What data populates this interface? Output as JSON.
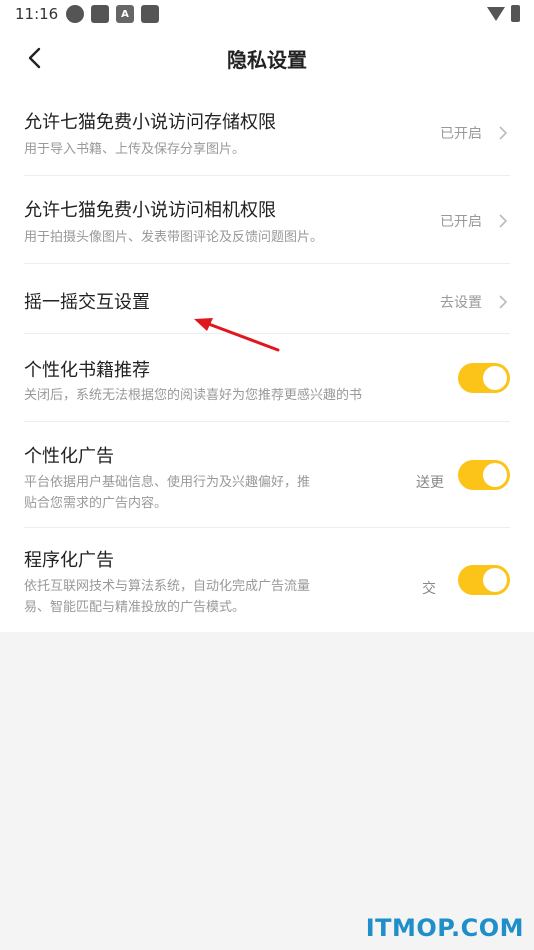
{
  "status_bar": {
    "time": "11:16",
    "icons": [
      "app-icon",
      "square-icon",
      "a-icon",
      "square-icon"
    ],
    "right_icons": [
      "wifi-icon",
      "battery-icon"
    ]
  },
  "header": {
    "title": "隐私设置",
    "back_icon": "chevron-left-icon"
  },
  "settings": [
    {
      "title": "允许七猫免费小说访问存储权限",
      "subtitle": "用于导入书籍、上传及保存分享图片。",
      "status": "已开启"
    },
    {
      "title": "允许七猫免费小说访问相机权限",
      "subtitle": "用于拍摄头像图片、发表带图评论及反馈问题图片。",
      "status": "已开启"
    },
    {
      "title": "摇一摇交互设置",
      "status": "去设置"
    },
    {
      "title": "个性化书籍推荐",
      "subtitle": "关闭后，系统无法根据您的阅读喜好为您推荐更感兴趣的书",
      "toggle": true
    },
    {
      "title": "个性化广告",
      "subtitle1": "平台依据用户基础信息、使用行为及兴趣偏好，推",
      "subtitle2": "贴合您需求的广告内容。",
      "fragment": "送更",
      "toggle": true
    },
    {
      "title": "程序化广告",
      "subtitle1": "依托互联网技术与算法系统，自动化完成广告流量",
      "subtitle2": "易、智能匹配与精准投放的广告模式。",
      "fragment": "交",
      "toggle": true
    }
  ],
  "colors": {
    "accent": "#fcc419",
    "annotation_arrow": "#e0181b",
    "watermark": "#1e8fc9"
  },
  "watermark": "ITMOP.COM"
}
